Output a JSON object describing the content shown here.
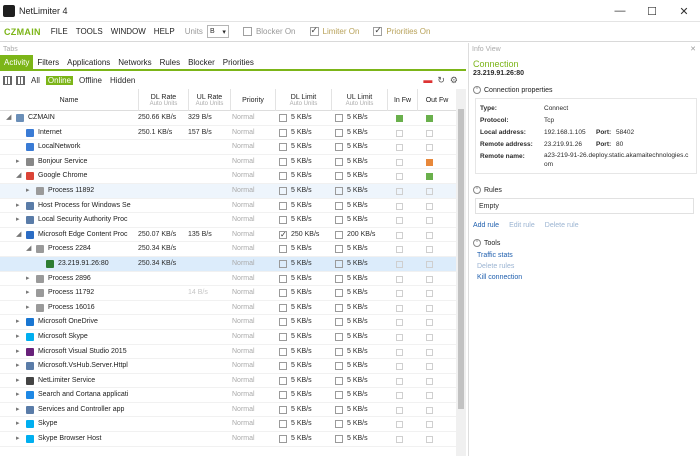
{
  "window": {
    "title": "NetLimiter 4",
    "controls": [
      "—",
      "☐",
      "✕"
    ]
  },
  "menubar": {
    "brand": "CZMAIN",
    "items": [
      "FILE",
      "TOOLS",
      "WINDOW",
      "HELP"
    ],
    "units_label": "Units",
    "units_value": "B",
    "toggles": [
      {
        "label": "Blocker On",
        "checked": false
      },
      {
        "label": "Limiter On",
        "checked": true
      },
      {
        "label": "Priorities On",
        "checked": true
      }
    ]
  },
  "tabs_header": "Tabs",
  "tabs": [
    "Activity",
    "Filters",
    "Applications",
    "Networks",
    "Rules",
    "Blocker",
    "Priorities"
  ],
  "filters": [
    "All",
    "Online",
    "Offline",
    "Hidden"
  ],
  "columns": [
    {
      "label": "Name",
      "sub": ""
    },
    {
      "label": "DL Rate",
      "sub": "Auto Units"
    },
    {
      "label": "UL Rate",
      "sub": "Auto Units"
    },
    {
      "label": "Priority",
      "sub": ""
    },
    {
      "label": "DL Limit",
      "sub": "Auto Units"
    },
    {
      "label": "UL Limit",
      "sub": "Auto Units"
    },
    {
      "label": "In Fw",
      "sub": ""
    },
    {
      "label": "Out Fw",
      "sub": ""
    }
  ],
  "rows": [
    {
      "name": "CZMAIN",
      "arrow": "◢",
      "indent": 0,
      "icon": "#6b8fb8",
      "dl": "250.66 KB/s",
      "ul": "329 B/s",
      "prio": "Normal",
      "dlim": "5 KB/s",
      "ulim": "5 KB/s",
      "dlim_checked": false,
      "ulim_checked": false,
      "infw": "green",
      "outfw": "green",
      "muted": false
    },
    {
      "name": "Internet",
      "arrow": "",
      "indent": 1,
      "icon": "#3a7bd5",
      "dl": "250.1 KB/s",
      "ul": "157 B/s",
      "prio": "Normal",
      "dlim": "5 KB/s",
      "ulim": "5 KB/s",
      "dlim_checked": false,
      "ulim_checked": false,
      "infw": "",
      "outfw": "",
      "muted": false
    },
    {
      "name": "LocalNetwork",
      "arrow": "",
      "indent": 1,
      "icon": "#3a7bd5",
      "dl": "",
      "ul": "",
      "prio": "Normal",
      "dlim": "5 KB/s",
      "ulim": "5 KB/s",
      "dlim_checked": false,
      "ulim_checked": false,
      "infw": "",
      "outfw": "",
      "muted": true
    },
    {
      "name": "Bonjour Service",
      "arrow": "▸",
      "indent": 1,
      "icon": "#888888",
      "dl": "",
      "ul": "",
      "prio": "Normal",
      "dlim": "5 KB/s",
      "ulim": "5 KB/s",
      "dlim_checked": false,
      "ulim_checked": false,
      "infw": "",
      "outfw": "orange",
      "muted": true
    },
    {
      "name": "Google Chrome",
      "arrow": "◢",
      "indent": 1,
      "icon": "#db4437",
      "dl": "",
      "ul": "",
      "prio": "Normal",
      "dlim": "5 KB/s",
      "ulim": "5 KB/s",
      "dlim_checked": false,
      "ulim_checked": false,
      "infw": "",
      "outfw": "green",
      "muted": true
    },
    {
      "name": "Process 11892",
      "arrow": "▸",
      "indent": 2,
      "icon": "#9a9a9a",
      "dl": "",
      "ul": "",
      "prio": "Normal",
      "dlim": "5 KB/s",
      "ulim": "5 KB/s",
      "dlim_checked": false,
      "ulim_checked": false,
      "infw": "",
      "outfw": "",
      "muted": true,
      "hl": true
    },
    {
      "name": "Host Process for Windows Se",
      "arrow": "▸",
      "indent": 1,
      "icon": "#5a7ca8",
      "dl": "",
      "ul": "",
      "prio": "Normal",
      "dlim": "5 KB/s",
      "ulim": "5 KB/s",
      "dlim_checked": false,
      "ulim_checked": false,
      "infw": "",
      "outfw": "",
      "muted": true
    },
    {
      "name": "Local Security Authority Proc",
      "arrow": "▸",
      "indent": 1,
      "icon": "#5a7ca8",
      "dl": "",
      "ul": "",
      "prio": "Normal",
      "dlim": "5 KB/s",
      "ulim": "5 KB/s",
      "dlim_checked": false,
      "ulim_checked": false,
      "infw": "",
      "outfw": "",
      "muted": true
    },
    {
      "name": "Microsoft Edge Content Proc",
      "arrow": "◢",
      "indent": 1,
      "icon": "#2b6cc4",
      "dl": "250.07 KB/s",
      "ul": "135 B/s",
      "prio": "Normal",
      "dlim": "250 KB/s",
      "ulim": "200 KB/s",
      "dlim_checked": true,
      "ulim_checked": false,
      "infw": "",
      "outfw": "",
      "muted": false
    },
    {
      "name": "Process 2284",
      "arrow": "◢",
      "indent": 2,
      "icon": "#9a9a9a",
      "dl": "250.34 KB/s",
      "ul": "",
      "prio": "Normal",
      "dlim": "5 KB/s",
      "ulim": "5 KB/s",
      "dlim_checked": false,
      "ulim_checked": false,
      "infw": "",
      "outfw": "",
      "muted": false
    },
    {
      "name": "23.219.91.26:80",
      "arrow": "",
      "indent": 3,
      "icon": "#2e7d32",
      "dl": "250.34 KB/s",
      "ul": "",
      "prio": "Normal",
      "dlim": "5 KB/s",
      "ulim": "5 KB/s",
      "dlim_checked": false,
      "ulim_checked": false,
      "infw": "",
      "outfw": "",
      "muted": false,
      "sel": true
    },
    {
      "name": "Process 2896",
      "arrow": "▸",
      "indent": 2,
      "icon": "#9a9a9a",
      "dl": "",
      "ul": "",
      "prio": "Normal",
      "dlim": "5 KB/s",
      "ulim": "5 KB/s",
      "dlim_checked": false,
      "ulim_checked": false,
      "infw": "",
      "outfw": "",
      "muted": true
    },
    {
      "name": "Process 11792",
      "arrow": "▸",
      "indent": 2,
      "icon": "#9a9a9a",
      "dl": "",
      "ul": "14 B/s",
      "prio": "Normal",
      "dlim": "5 KB/s",
      "ulim": "5 KB/s",
      "dlim_checked": false,
      "ulim_checked": false,
      "infw": "",
      "outfw": "",
      "muted": true
    },
    {
      "name": "Process 16016",
      "arrow": "▸",
      "indent": 2,
      "icon": "#9a9a9a",
      "dl": "",
      "ul": "",
      "prio": "Normal",
      "dlim": "5 KB/s",
      "ulim": "5 KB/s",
      "dlim_checked": false,
      "ulim_checked": false,
      "infw": "",
      "outfw": "",
      "muted": true
    },
    {
      "name": "Microsoft OneDrive",
      "arrow": "▸",
      "indent": 1,
      "icon": "#1976d2",
      "dl": "",
      "ul": "",
      "prio": "Normal",
      "dlim": "5 KB/s",
      "ulim": "5 KB/s",
      "dlim_checked": false,
      "ulim_checked": false,
      "infw": "",
      "outfw": "",
      "muted": true
    },
    {
      "name": "Microsoft Skype",
      "arrow": "▸",
      "indent": 1,
      "icon": "#00aff0",
      "dl": "",
      "ul": "",
      "prio": "Normal",
      "dlim": "5 KB/s",
      "ulim": "5 KB/s",
      "dlim_checked": false,
      "ulim_checked": false,
      "infw": "",
      "outfw": "",
      "muted": true
    },
    {
      "name": "Microsoft Visual Studio 2015",
      "arrow": "▸",
      "indent": 1,
      "icon": "#68217a",
      "dl": "",
      "ul": "",
      "prio": "Normal",
      "dlim": "5 KB/s",
      "ulim": "5 KB/s",
      "dlim_checked": false,
      "ulim_checked": false,
      "infw": "",
      "outfw": "",
      "muted": true
    },
    {
      "name": "Microsoft.VsHub.Server.Httpl",
      "arrow": "▸",
      "indent": 1,
      "icon": "#5a7ca8",
      "dl": "",
      "ul": "",
      "prio": "Normal",
      "dlim": "5 KB/s",
      "ulim": "5 KB/s",
      "dlim_checked": false,
      "ulim_checked": false,
      "infw": "",
      "outfw": "",
      "muted": true
    },
    {
      "name": "NetLimiter Service",
      "arrow": "▸",
      "indent": 1,
      "icon": "#444444",
      "dl": "",
      "ul": "",
      "prio": "Normal",
      "dlim": "5 KB/s",
      "ulim": "5 KB/s",
      "dlim_checked": false,
      "ulim_checked": false,
      "infw": "",
      "outfw": "",
      "muted": true
    },
    {
      "name": "Search and Cortana applicati",
      "arrow": "▸",
      "indent": 1,
      "icon": "#1e88e5",
      "dl": "",
      "ul": "",
      "prio": "Normal",
      "dlim": "5 KB/s",
      "ulim": "5 KB/s",
      "dlim_checked": false,
      "ulim_checked": false,
      "infw": "",
      "outfw": "",
      "muted": true
    },
    {
      "name": "Services and Controller app",
      "arrow": "▸",
      "indent": 1,
      "icon": "#5a7ca8",
      "dl": "",
      "ul": "",
      "prio": "Normal",
      "dlim": "5 KB/s",
      "ulim": "5 KB/s",
      "dlim_checked": false,
      "ulim_checked": false,
      "infw": "",
      "outfw": "",
      "muted": true
    },
    {
      "name": "Skype",
      "arrow": "▸",
      "indent": 1,
      "icon": "#00aff0",
      "dl": "",
      "ul": "",
      "prio": "Normal",
      "dlim": "5 KB/s",
      "ulim": "5 KB/s",
      "dlim_checked": false,
      "ulim_checked": false,
      "infw": "",
      "outfw": "",
      "muted": true
    },
    {
      "name": "Skype Browser Host",
      "arrow": "▸",
      "indent": 1,
      "icon": "#00aff0",
      "dl": "",
      "ul": "",
      "prio": "Normal",
      "dlim": "5 KB/s",
      "ulim": "5 KB/s",
      "dlim_checked": false,
      "ulim_checked": false,
      "infw": "",
      "outfw": "",
      "muted": true
    }
  ],
  "info": {
    "header": "Info View",
    "title": "Connection",
    "ip": "23.219.91.26:80",
    "props_title": "Connection properties",
    "props": {
      "type_label": "Type:",
      "type": "Connect",
      "protocol_label": "Protocol:",
      "protocol": "Tcp",
      "local_label": "Local address:",
      "local": "192.168.1.105",
      "local_port_label": "Port:",
      "local_port": "58402",
      "remote_label": "Remote address:",
      "remote": "23.219.91.26",
      "remote_port_label": "Port:",
      "remote_port": "80",
      "remote_name_label": "Remote name:",
      "remote_name": "a23-219-91-26.deploy.static.akamaitechnologies.com"
    },
    "rules_title": "Rules",
    "rules_value": "Empty",
    "rule_links": [
      "Add rule",
      "Edit rule",
      "Delete rule"
    ],
    "tools_title": "Tools",
    "tools": [
      "Traffic stats",
      "Delete rules",
      "Kill connection"
    ]
  }
}
